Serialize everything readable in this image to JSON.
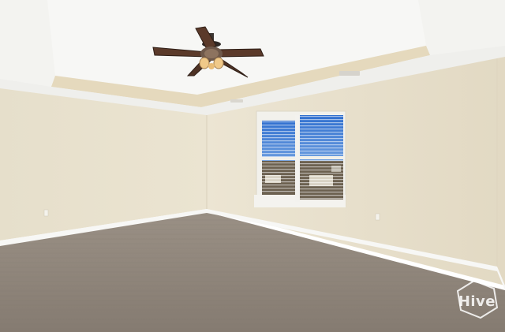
{
  "image": {
    "subject": "empty-room-interior"
  },
  "watermark": {
    "text": "Hive"
  },
  "colors": {
    "wall": "#e8e0cc",
    "ceiling": "#f4f4f1",
    "tray_recess": "#e7dcc0",
    "carpet": "#8f857b",
    "baseboard": "#f6f6f4",
    "fan_blade": "#5b3a2a",
    "sky": "#3f7fd1"
  }
}
